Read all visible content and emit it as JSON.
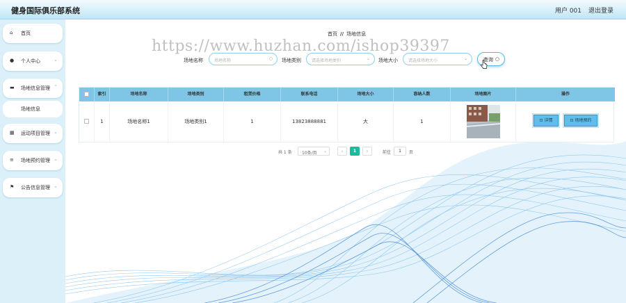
{
  "header": {
    "title": "健身国际俱乐部系统",
    "user": "用户 001",
    "logout": "退出登录"
  },
  "sidebar": {
    "items": [
      {
        "label": "首页",
        "icon": "home-icon",
        "glyph": "⌂"
      },
      {
        "label": "个人中心",
        "icon": "user-icon",
        "glyph": "●"
      },
      {
        "label": "场地信息管理",
        "icon": "monitor-icon",
        "glyph": "▬"
      },
      {
        "label": "运动项目管理",
        "icon": "grid-icon",
        "glyph": "▦"
      },
      {
        "label": "场地预约管理",
        "icon": "sliders-icon",
        "glyph": "≡"
      },
      {
        "label": "公告信息管理",
        "icon": "flag-icon",
        "glyph": "⚑"
      }
    ],
    "sub_item": "场地信息"
  },
  "breadcrumb": {
    "home": "首页",
    "separator": "//",
    "current": "场地信息"
  },
  "watermark": "https://www.huzhan.com/ishop39397",
  "filters": {
    "name_label": "场地名称",
    "name_placeholder": "场地名称",
    "type_label": "场地类别",
    "type_placeholder": "请选择场地类别",
    "size_label": "场地大小",
    "size_placeholder": "请选择场地大小",
    "search_label": "查询"
  },
  "table": {
    "headers": [
      "索引",
      "场地名称",
      "场地类别",
      "租赁价格",
      "联系电话",
      "场地大小",
      "容纳人数",
      "场地图片",
      "操作"
    ],
    "row": {
      "index": "1",
      "name": "场地名称1",
      "type": "场地类别1",
      "price": "1",
      "phone": "13823888881",
      "size": "大",
      "capacity": "1"
    },
    "actions": {
      "detail": "详情",
      "book": "场地预约"
    }
  },
  "pagination": {
    "total": "共 1 条",
    "page_size": "10条/页",
    "current": "1",
    "goto_label": "前往",
    "goto_value": "1",
    "page_unit": "页"
  },
  "colors": {
    "header_bg": "#7fc6e6",
    "accent": "#1abc9c",
    "button": "#63bde8"
  }
}
